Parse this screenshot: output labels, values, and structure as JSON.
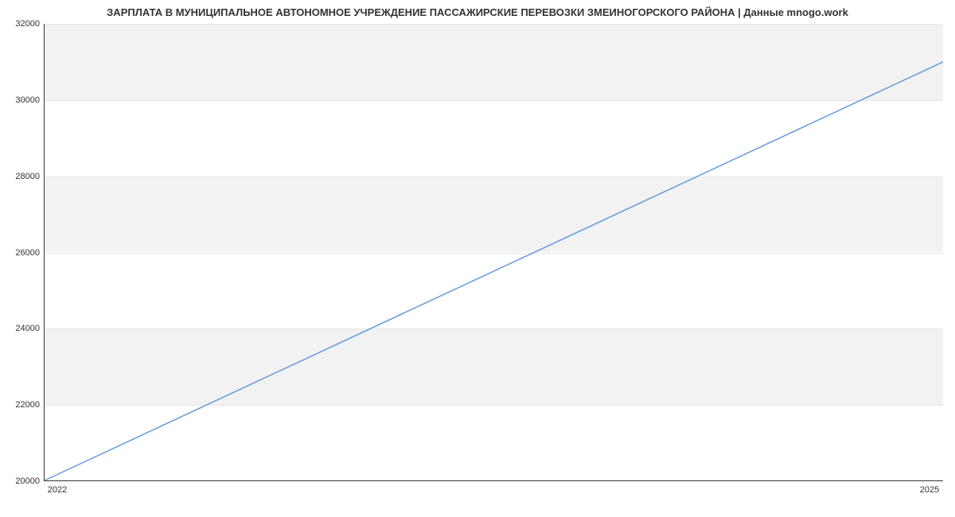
{
  "chart_data": {
    "type": "line",
    "title": "ЗАРПЛАТА В МУНИЦИПАЛЬНОЕ АВТОНОМНОЕ УЧРЕЖДЕНИЕ ПАССАЖИРСКИЕ ПЕРЕВОЗКИ ЗМЕИНОГОРСКОГО РАЙОНА | Данные mnogo.work",
    "x": [
      2022,
      2025
    ],
    "values": [
      20000,
      31000
    ],
    "xlabel": "",
    "ylabel": "",
    "xlim": [
      2022,
      2025
    ],
    "ylim": [
      20000,
      32000
    ],
    "y_ticks": [
      20000,
      22000,
      24000,
      26000,
      28000,
      30000,
      32000
    ],
    "x_ticks": [
      2022,
      2025
    ],
    "grid": true,
    "line_color": "#6699dd",
    "band_color": "#f2f2f2"
  }
}
